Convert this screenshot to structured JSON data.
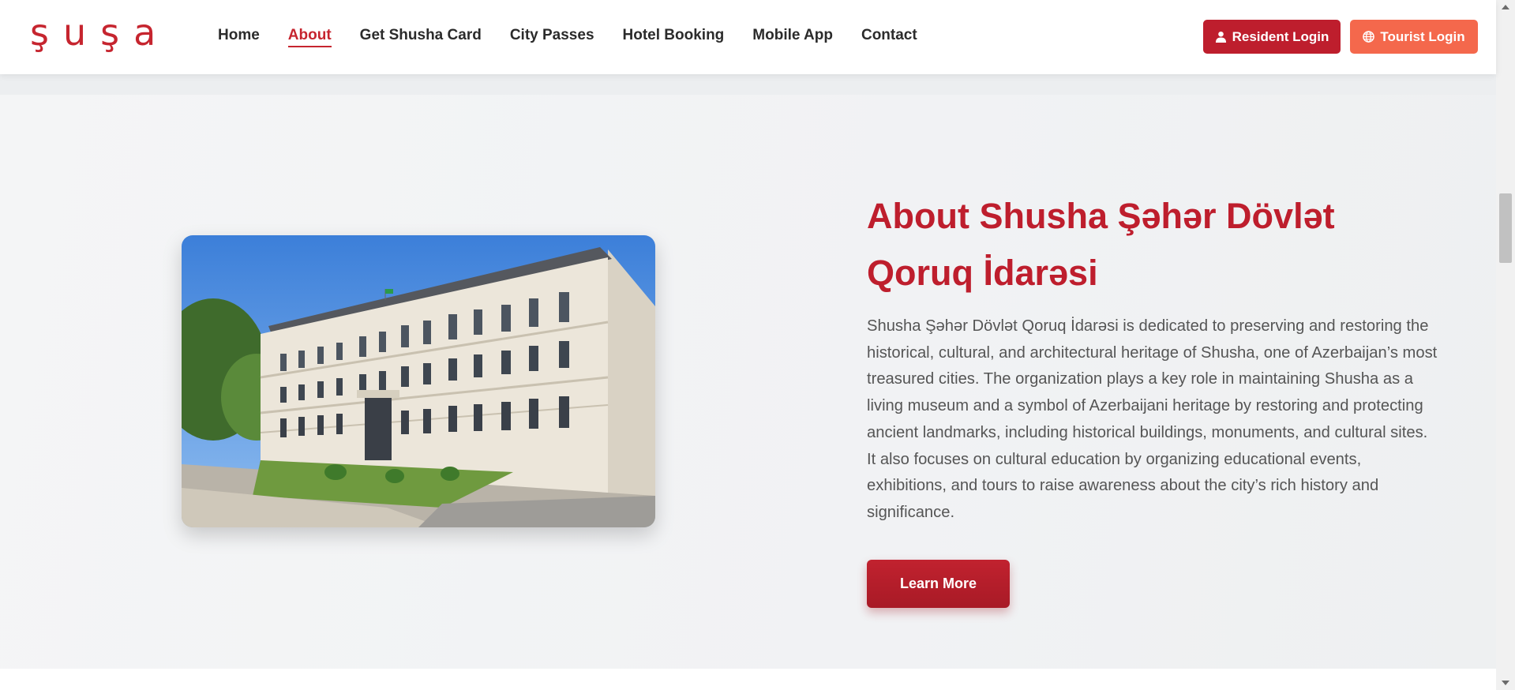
{
  "header": {
    "logo_text": "şuşa",
    "nav": [
      {
        "label": "Home"
      },
      {
        "label": "About",
        "active": true
      },
      {
        "label": "Get Shusha Card"
      },
      {
        "label": "City Passes"
      },
      {
        "label": "Hotel Booking"
      },
      {
        "label": "Mobile App"
      },
      {
        "label": "Contact"
      }
    ],
    "resident_login": {
      "label": "Resident Login",
      "icon": "user-icon",
      "color": "#be1e2d"
    },
    "tourist_login": {
      "label": "Tourist Login",
      "icon": "globe-icon",
      "color": "#f4684c"
    }
  },
  "about": {
    "title": "About Shusha Şəhər Dövlət Qoruq İdarəsi",
    "description": "Shusha Şəhər Dövlət Qoruq İdarəsi is dedicated to preserving and restoring the historical, cultural, and architectural heritage of Shusha, one of Azerbaijan’s most treasured cities. The organization plays a key role in maintaining Shusha as a living museum and a symbol of Azerbaijani heritage by restoring and protecting ancient landmarks, including historical buildings, monuments, and cultural sites. It also focuses on cultural education by organizing educational events, exhibitions, and tours to raise awareness about the city’s rich history and significance.",
    "button_label": "Learn More",
    "accent_color": "#be1e2d"
  }
}
